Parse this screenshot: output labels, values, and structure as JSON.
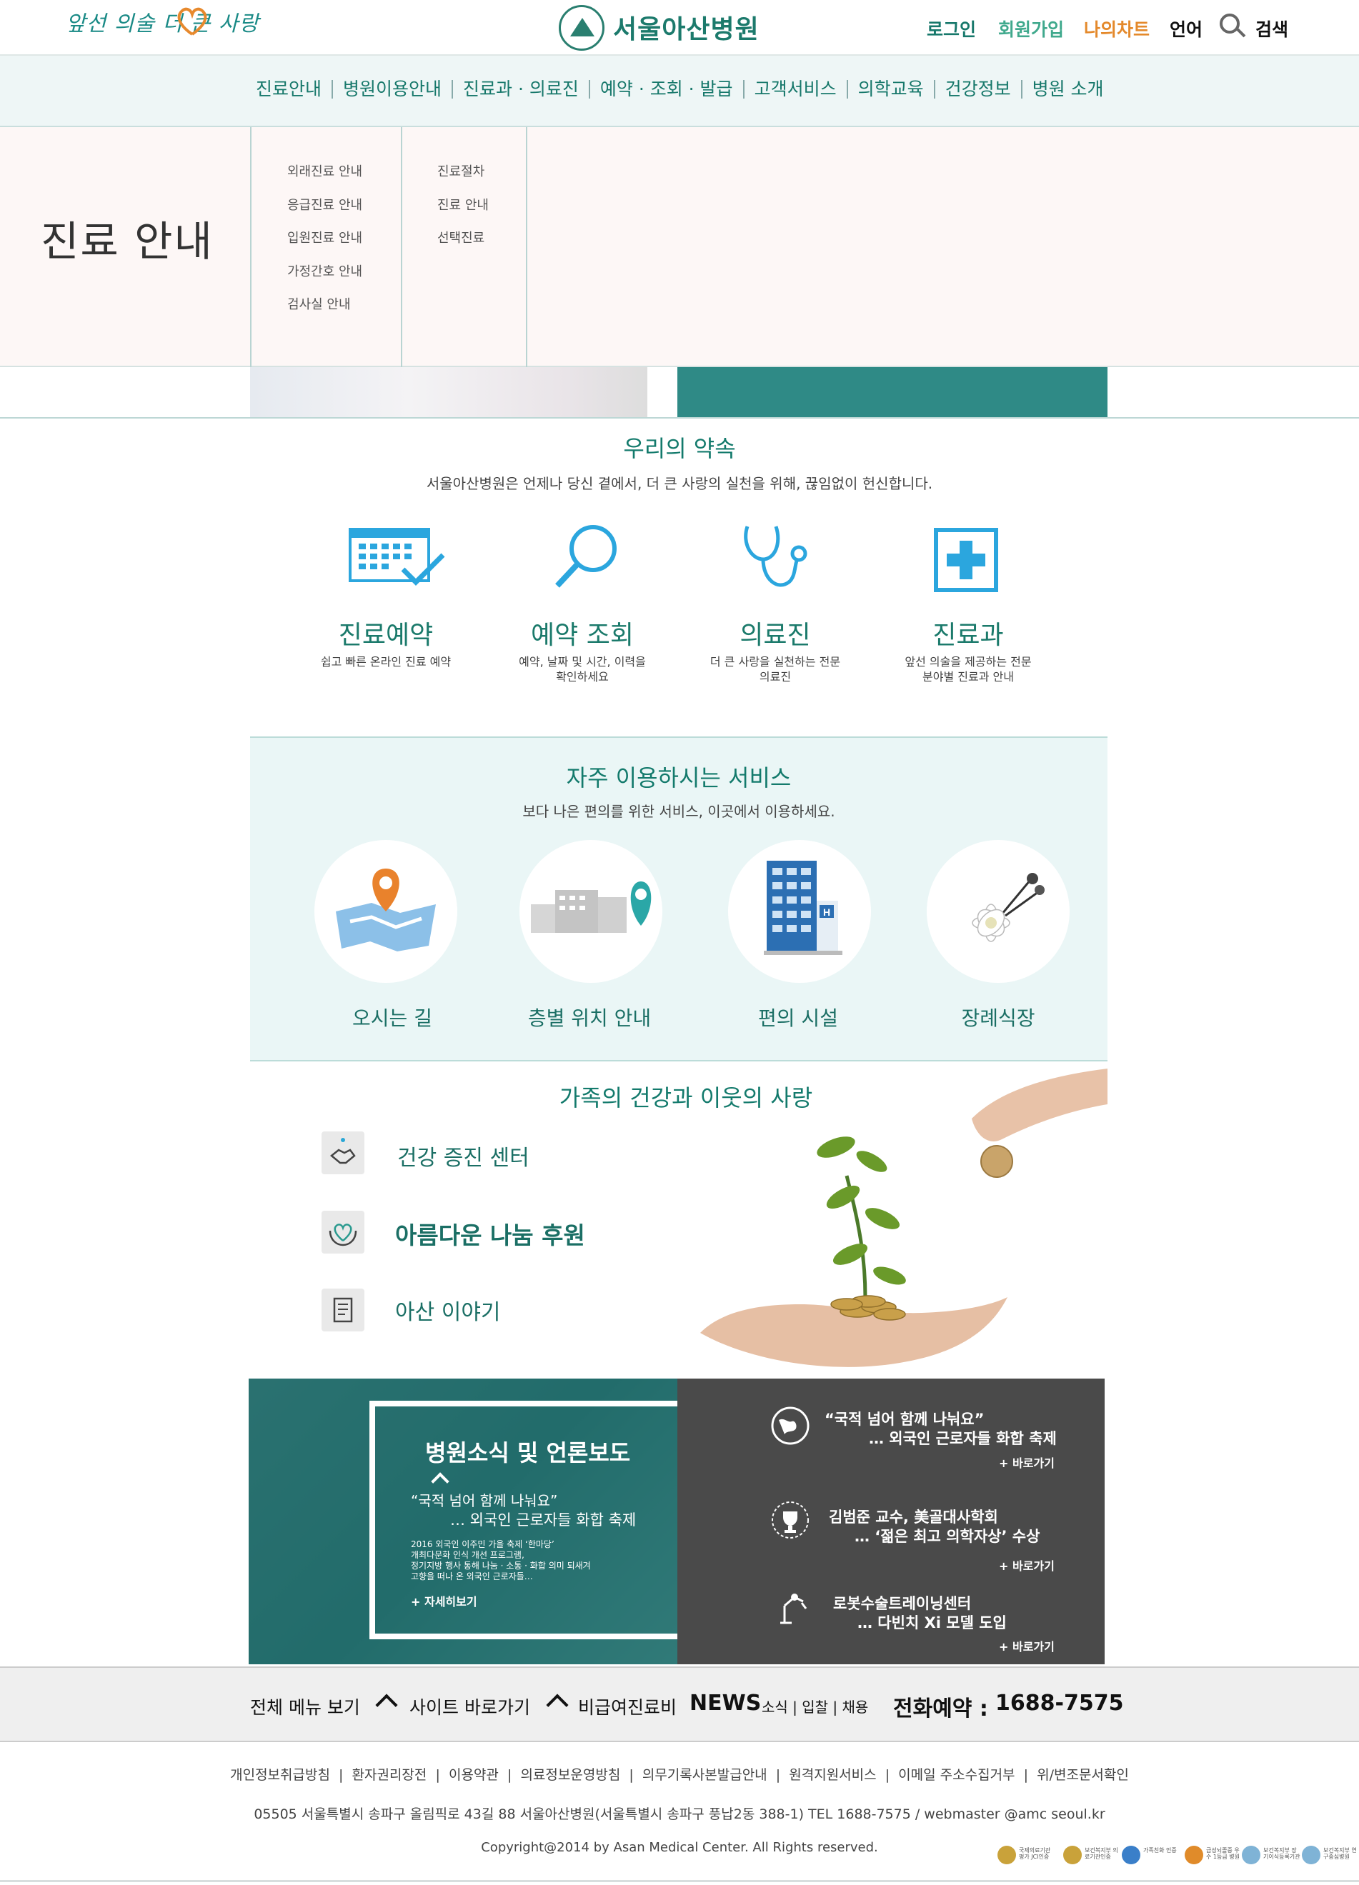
{
  "header": {
    "slogan": "앞선 의술 더 큰 사랑",
    "logo_text": "서울아산병원",
    "login": "로그인",
    "join": "회원가입",
    "my_chart": "나의차트",
    "language": "언어",
    "search": "검색"
  },
  "gnb": [
    "진료안내",
    "병원이용안내",
    "진료과 · 의료진",
    "예약 · 조회 · 발급",
    "고객서비스",
    "의학교육",
    "건강정보",
    "병원 소개"
  ],
  "mega": {
    "title": "진료 안내",
    "col1": [
      "외래진료 안내",
      "응급진료 안내",
      "입원진료 안내",
      "가정간호 안내",
      "검사실 안내"
    ],
    "col2": [
      "진료절차",
      "진료 안내",
      "선택진료"
    ]
  },
  "promise": {
    "title": "우리의 약속",
    "subtitle": "서울아산병원은 언제나 당신 곁에서, 더 큰 사랑의 실천을 위해, 끊임없이 헌신합니다.",
    "cards": [
      {
        "title": "진료예약",
        "desc": "쉽고 빠른 온라인 진료 예약",
        "icon": "calendar-check-icon"
      },
      {
        "title": "예약 조회",
        "desc": "예약, 날짜 및 시간, 이력을 확인하세요",
        "icon": "magnifier-icon"
      },
      {
        "title": "의료진",
        "desc": "더 큰 사랑을 실천하는 전문 의료진",
        "icon": "stethoscope-icon"
      },
      {
        "title": "진료과",
        "desc": "앞선 의술을 제공하는 전문 분야별 진료과 안내",
        "icon": "medical-cross-icon"
      }
    ]
  },
  "services": {
    "title": "자주 이용하시는 서비스",
    "subtitle": "보다 나은 편의를 위한 서비스, 이곳에서 이용하세요.",
    "items": [
      {
        "label": "오시는 길",
        "icon": "map-pin-icon"
      },
      {
        "label": "층별 위치 안내",
        "icon": "building-location-icon"
      },
      {
        "label": "편의 시설",
        "icon": "hospital-building-icon"
      },
      {
        "label": "장례식장",
        "icon": "flower-icon"
      }
    ]
  },
  "family": {
    "title": "가족의 건강과 이웃의 사랑",
    "items": [
      "건강 증진 센터",
      "아름다운 나눔 후원",
      "아산 이야기"
    ]
  },
  "news": {
    "box_title": "병원소식 및 언론보도",
    "box_headline_1": "“국적 넘어 함께 나눠요”",
    "box_headline_2": "… 외국인 근로자들 화합 축제",
    "box_body": [
      "2016 외국인 이주민 가을 축제 ‘한마당’",
      "개최다문화 인식 개선 프로그램,",
      "정기지방 행사 통해 나눔 · 소통 · 화합 의미 되새겨",
      "고향을 떠나 온 외국인 근로자들…"
    ],
    "box_more": "+ 자세히보기",
    "items": [
      {
        "line1": "“국적 넘어 함께 나눠요”",
        "line2": "… 외국인 근로자들 화합 축제",
        "more": "+ 바로가기"
      },
      {
        "line1": "김범준 교수, 美골대사학회",
        "line2": "… ‘젊은 최고 의학자상’ 수상",
        "more": "+ 바로가기"
      },
      {
        "line1": "로봇수술트레이닝센터",
        "line2": "… 다빈치 Xi 모델 도입",
        "more": "+ 바로가기"
      }
    ]
  },
  "quick": {
    "all_menu": "전체 메뉴 보기",
    "site_go": "사이트 바로가기",
    "fee": "비급여진료비",
    "news": "NEWS",
    "news_links": "소식 | 입찰 | 채용",
    "phone_label": "전화예약 :",
    "phone": "1688-7575"
  },
  "footer": {
    "links": [
      "개인정보취급방침",
      "환자권리장전",
      "이용약관",
      "의료정보운영방침",
      "의무기록사본발급안내",
      "원격지원서비스",
      "이메일 주소수집거부",
      "위/변조문서확인"
    ],
    "address": "05505 서울특별시 송파구 올림픽로 43길 88 서울아산병원(서울특별시 송파구 풍납2동 388-1)  TEL 1688-7575  / webmaster @amc seoul.kr",
    "copyright": "Copyright@2014 by Asan Medical Center. All Rights reserved.",
    "certs": [
      {
        "text": "국제의료기관 평가 JCI인증",
        "color": "#c9a23a"
      },
      {
        "text": "보건복지부 의료기관인증",
        "color": "#c9a23a"
      },
      {
        "text": "가족친화 인증",
        "color": "#3a7fc9"
      },
      {
        "text": "급성뇌졸중 우수 1등급 병원",
        "color": "#e08b2a"
      },
      {
        "text": "보건복지부 장기이식등록기관",
        "color": "#7fb3d6"
      },
      {
        "text": "보건복지부 연구중심병원",
        "color": "#7fb3d6"
      }
    ]
  },
  "colors": {
    "brand": "#17786b",
    "my_chart": "#e4892b",
    "news_dark": "#4a4a4a"
  }
}
